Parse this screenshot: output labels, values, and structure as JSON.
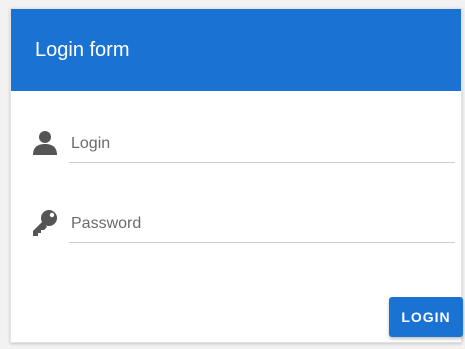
{
  "header": {
    "title": "Login form",
    "color": "#1a73d2"
  },
  "form": {
    "login": {
      "icon": "user-icon",
      "placeholder": "Login",
      "value": ""
    },
    "password": {
      "icon": "key-icon",
      "placeholder": "Password",
      "value": ""
    }
  },
  "actions": {
    "login_label": "LOGIN",
    "button_color": "#1a73d2"
  }
}
